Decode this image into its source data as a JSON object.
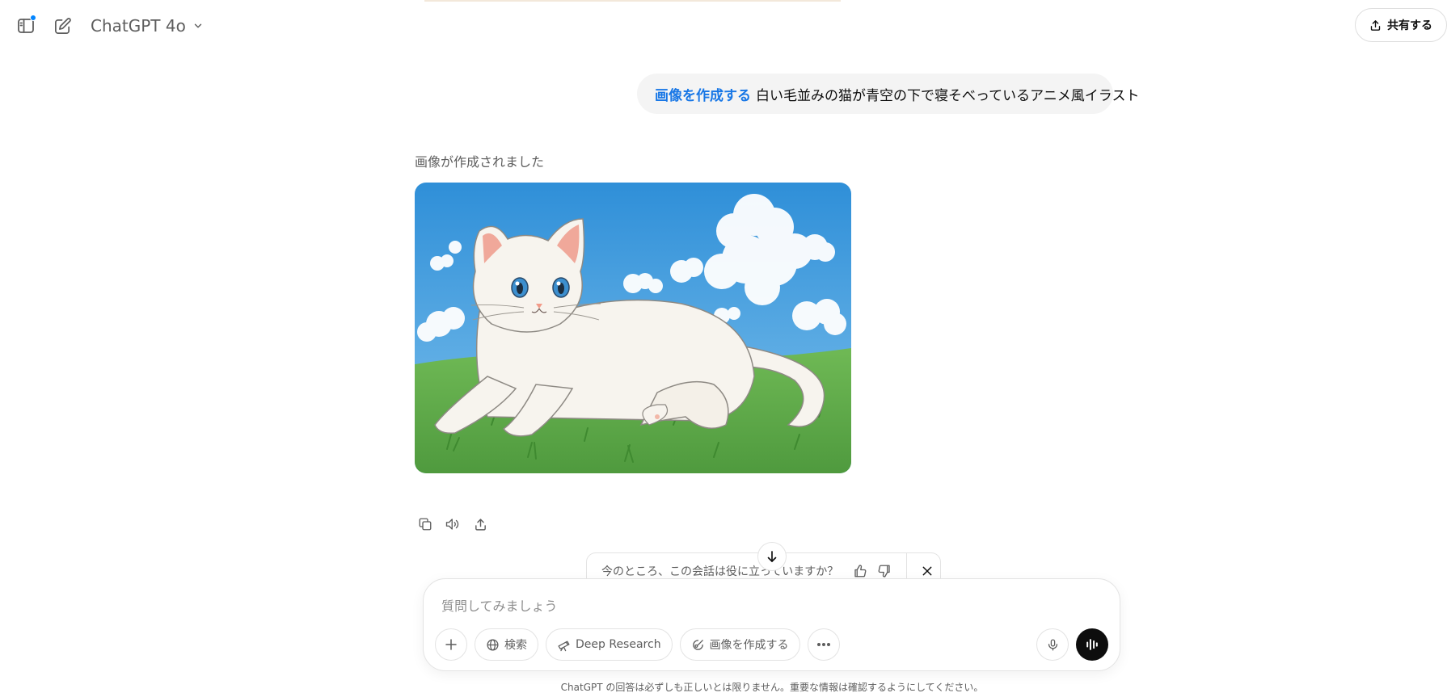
{
  "header": {
    "model_name": "ChatGPT 4o",
    "share_label": "共有する"
  },
  "user_message": {
    "tool_tag": "画像を作成する",
    "text": "白い毛並みの猫が青空の下で寝そべっているアニメ風イラスト"
  },
  "assistant": {
    "status_text": "画像が作成されました"
  },
  "feedback": {
    "question": "今のところ、この会話は役に立っていますか？"
  },
  "composer": {
    "placeholder": "質問してみましょう",
    "tools": {
      "search_label": "検索",
      "deep_research_label": "Deep Research",
      "create_image_label": "画像を作成する"
    }
  },
  "footer": {
    "disclaimer": "ChatGPT の回答は必ずしも正しいとは限りません。重要な情報は確認するようにしてください。"
  },
  "colors": {
    "accent": "#1877e6",
    "notification_dot": "#0285ff",
    "sky": "#3b97da",
    "grass": "#5fa84a"
  }
}
